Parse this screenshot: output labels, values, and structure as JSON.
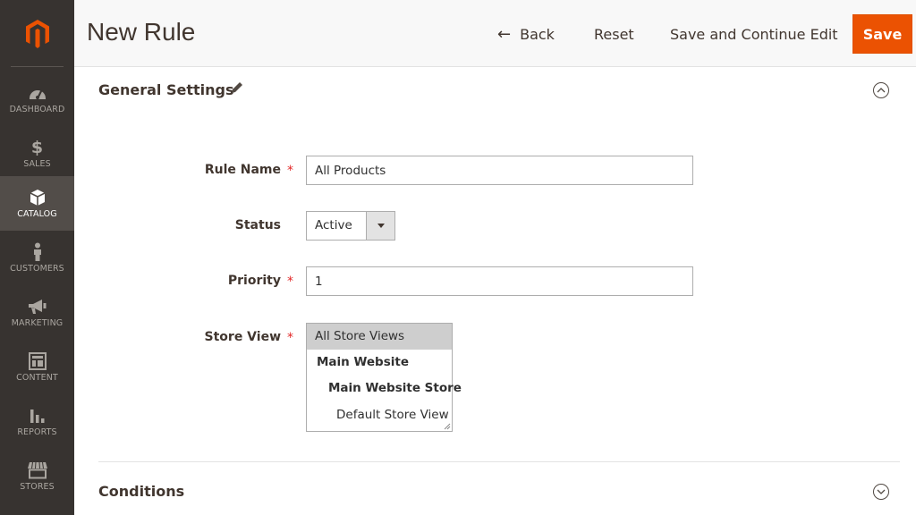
{
  "header": {
    "title": "New Rule",
    "back_label": "Back",
    "reset_label": "Reset",
    "save_continue_label": "Save and Continue Edit",
    "save_label": "Save"
  },
  "sidebar": {
    "items": [
      {
        "label": "DASHBOARD",
        "icon": "dashboard-icon"
      },
      {
        "label": "SALES",
        "icon": "dollar-icon"
      },
      {
        "label": "CATALOG",
        "icon": "box-icon",
        "active": true
      },
      {
        "label": "CUSTOMERS",
        "icon": "person-icon"
      },
      {
        "label": "MARKETING",
        "icon": "megaphone-icon"
      },
      {
        "label": "CONTENT",
        "icon": "layout-icon"
      },
      {
        "label": "REPORTS",
        "icon": "bar-chart-icon"
      },
      {
        "label": "STORES",
        "icon": "store-icon"
      }
    ],
    "dollar_glyph": "$"
  },
  "general_settings": {
    "title": "General Settings",
    "fields": {
      "rule_name": {
        "label": "Rule Name",
        "value": "All Products",
        "required": true
      },
      "status": {
        "label": "Status",
        "value": "Active"
      },
      "priority": {
        "label": "Priority",
        "value": "1",
        "required": true
      },
      "store_view": {
        "label": "Store View",
        "required": true,
        "options": [
          "All Store Views",
          "Main Website",
          "Main Website Store",
          "Default Store View"
        ],
        "selected": "All Store Views"
      }
    },
    "required_mark": "*"
  },
  "conditions": {
    "title": "Conditions"
  },
  "colors": {
    "sidebar_bg": "#373330",
    "sidebar_active": "#524d49",
    "save_button": "#eb5202",
    "logo": "#eb5202",
    "required": "#e22626"
  }
}
